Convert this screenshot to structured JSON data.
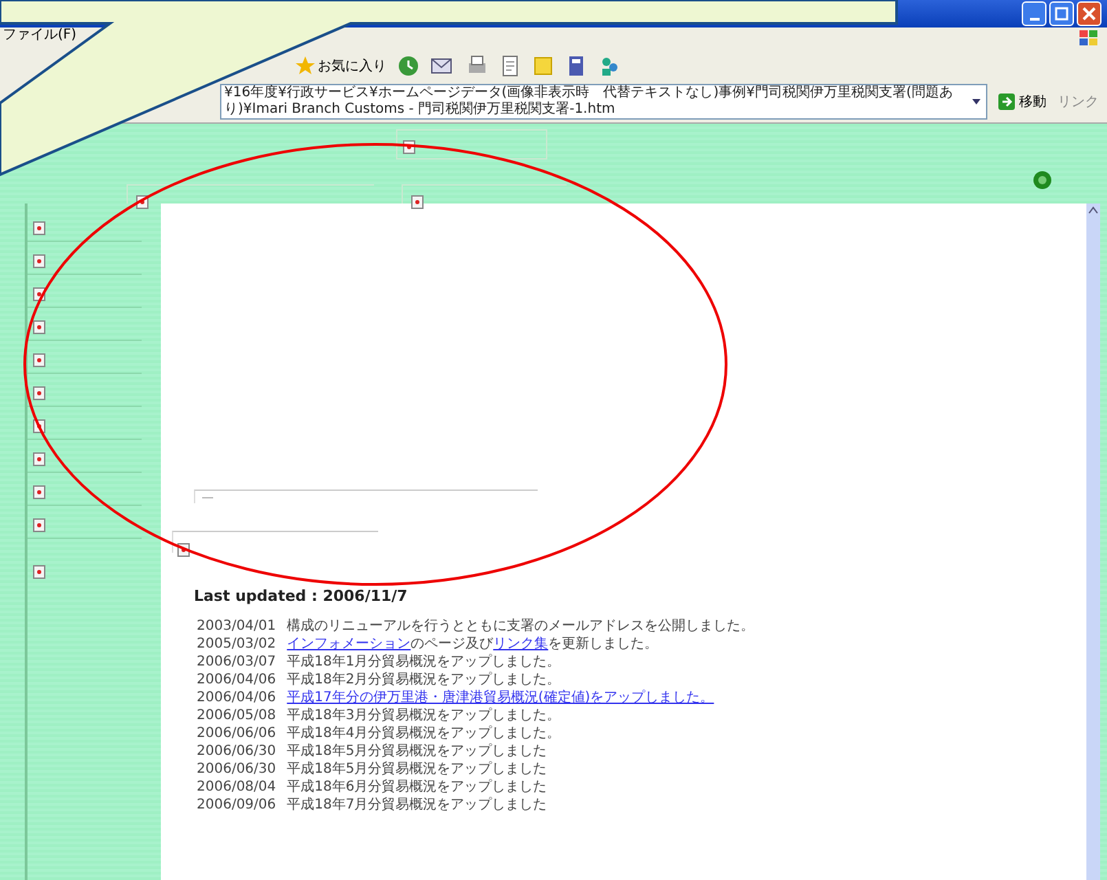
{
  "browser": {
    "menu": [
      {
        "label": "ファイル(F)"
      }
    ],
    "toolbar": {
      "favorites": "お気に入り"
    },
    "address": {
      "value": "¥16年度¥行政サービス¥ホームページデータ(画像非表示時　代替テキストなし)事例¥門司税関伊万里税関支署(問題あり)¥Imari Branch Customs - 門司税関伊万里税関支署-1.htm"
    },
    "go_button": "移動",
    "links": "リンク"
  },
  "page": {
    "last_updated": "Last updated : 2006/11/7",
    "news": [
      {
        "date": "2003/04/01",
        "parts": [
          {
            "text": "構成のリニューアルを行うとともに支署のメールアドレスを公開しました。",
            "link": false
          }
        ]
      },
      {
        "date": "2005/03/02",
        "parts": [
          {
            "text": "インフォメーション",
            "link": true
          },
          {
            "text": "のページ及び",
            "link": false
          },
          {
            "text": "リンク集",
            "link": true
          },
          {
            "text": "を更新しました。",
            "link": false
          }
        ]
      },
      {
        "date": "2006/03/07",
        "parts": [
          {
            "text": "平成18年1月分貿易概況をアップしました。",
            "link": false
          }
        ]
      },
      {
        "date": "2006/04/06",
        "parts": [
          {
            "text": "平成18年2月分貿易概況をアップしました。",
            "link": false
          }
        ]
      },
      {
        "date": "2006/04/06",
        "parts": [
          {
            "text": "平成17年分の伊万里港・唐津港貿易概況(確定値)をアップしました。",
            "link": true
          }
        ]
      },
      {
        "date": "2006/05/08",
        "parts": [
          {
            "text": "平成18年3月分貿易概況をアップしました。",
            "link": false
          }
        ]
      },
      {
        "date": "2006/06/06",
        "parts": [
          {
            "text": "平成18年4月分貿易概況をアップしました。",
            "link": false
          }
        ]
      },
      {
        "date": "2006/06/30",
        "parts": [
          {
            "text": "平成18年5月分貿易概況をアップしました",
            "link": false
          }
        ]
      },
      {
        "date": "2006/06/30",
        "parts": [
          {
            "text": "平成18年5月分貿易概況をアップしました",
            "link": false
          }
        ]
      },
      {
        "date": "2006/08/04",
        "parts": [
          {
            "text": "平成18年6月分貿易概況をアップしました",
            "link": false
          }
        ]
      },
      {
        "date": "2006/09/06",
        "parts": [
          {
            "text": "平成18年7月分貿易概況をアップしました",
            "link": false
          }
        ]
      }
    ]
  }
}
